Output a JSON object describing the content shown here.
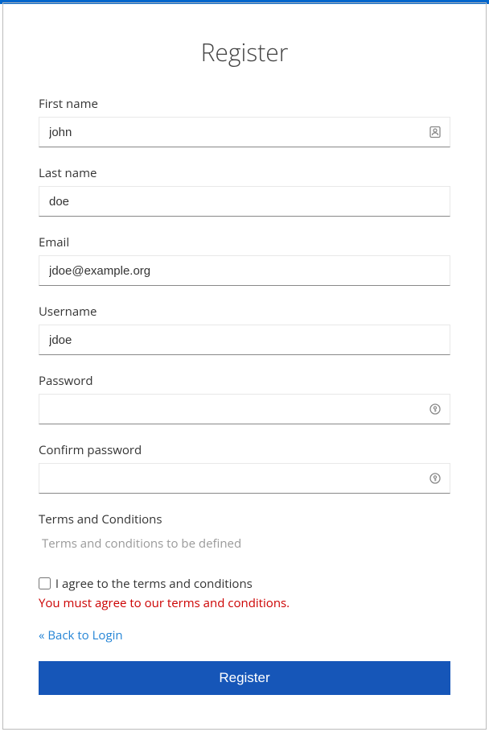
{
  "page": {
    "title": "Register"
  },
  "fields": {
    "first_name": {
      "label": "First name",
      "value": "john"
    },
    "last_name": {
      "label": "Last name",
      "value": "doe"
    },
    "email": {
      "label": "Email",
      "value": "jdoe@example.org"
    },
    "username": {
      "label": "Username",
      "value": "jdoe"
    },
    "password": {
      "label": "Password",
      "value": ""
    },
    "confirm_password": {
      "label": "Confirm password",
      "value": ""
    }
  },
  "terms": {
    "heading": "Terms and Conditions",
    "body": "Terms and conditions to be defined",
    "checkbox_label": "I agree to the terms and conditions",
    "error": "You must agree to our terms and conditions."
  },
  "links": {
    "back": "« Back to Login"
  },
  "buttons": {
    "submit": "Register"
  }
}
